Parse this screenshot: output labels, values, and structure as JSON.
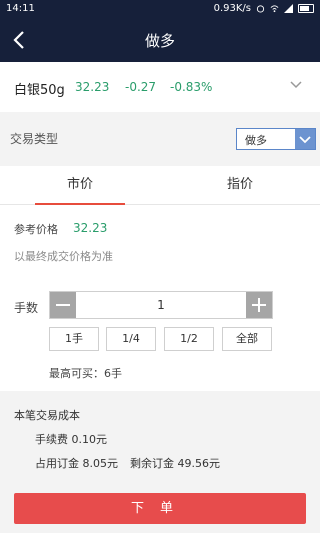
{
  "status_bar": {
    "time": "14:11",
    "network_speed": "0.93K/s",
    "icons": [
      "signal-icon",
      "wifi-icon",
      "battery-icon"
    ]
  },
  "navbar": {
    "title": "做多"
  },
  "quote": {
    "name": "白银50g",
    "price": "32.23",
    "change": "-0.27",
    "change_pct": "-0.83%",
    "color_change": "#2a9d6b"
  },
  "trade_type": {
    "label": "交易类型",
    "selected": "做多"
  },
  "tabs": [
    {
      "label": "市价",
      "active": true
    },
    {
      "label": "指价",
      "active": false
    }
  ],
  "order_form": {
    "ref_price_label": "参考价格",
    "ref_price_value": "32.23",
    "hint": "以最终成交价格为准",
    "quantity_label": "手数",
    "quantity_value": "1",
    "quick_buttons": [
      "1手",
      "1/4",
      "1/2",
      "全部"
    ],
    "max_buy": "最高可买：6手"
  },
  "cost": {
    "title": "本笔交易成本",
    "fee": "手续费 0.10元",
    "margin": "占用订金 8.05元",
    "remain": "剩余订金 49.56元"
  },
  "submit_label": "下单",
  "colors": {
    "header_bg": "#16203a",
    "accent_red": "#e74c4c",
    "select_blue": "#6c93d0"
  }
}
